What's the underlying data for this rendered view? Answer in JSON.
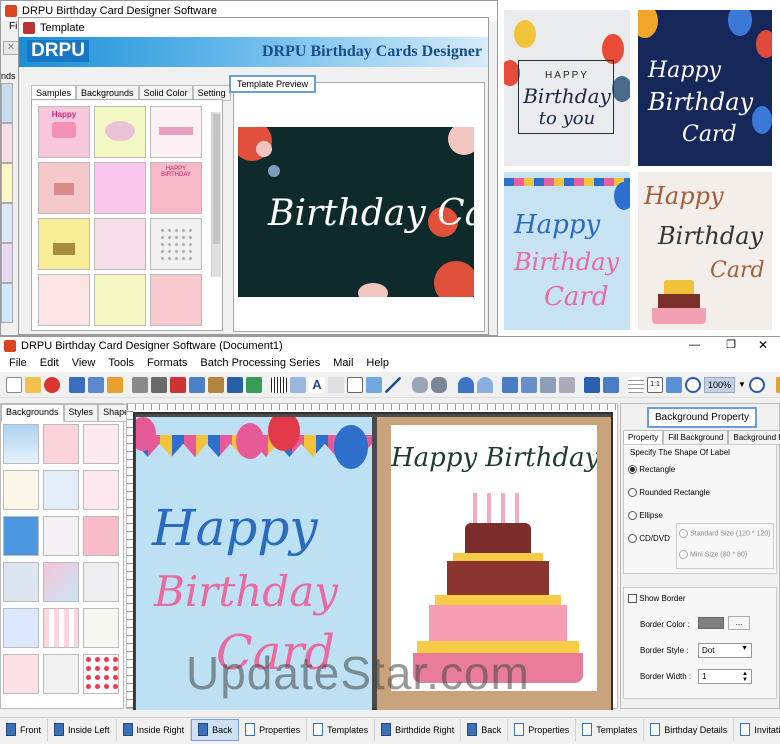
{
  "top_window": {
    "title": "DRPU Birthday Card Designer Software",
    "menu_partial": [
      "File"
    ],
    "left_strip_label": "nds"
  },
  "template_dialog": {
    "title": "Template",
    "logo": "DRPU",
    "banner": "DRPU Birthday Cards Designer",
    "tabs": [
      "Samples",
      "Backgrounds",
      "Solid Color",
      "Setting"
    ],
    "active_tab": "Samples",
    "preview_label": "Template Preview",
    "preview_text": "Birthday Card",
    "thumb_captions": {
      "t1": "Happy",
      "t6": "HAPPY BIRTHDAY"
    }
  },
  "top_right_cards": {
    "card1": [
      "HAPPY",
      "Birthday",
      "to you"
    ],
    "card2": [
      "Happy",
      "Birthday",
      "Card"
    ],
    "card3": [
      "Happy",
      "Birthday",
      "Card"
    ],
    "card4": [
      "Happy",
      "Birthday",
      "Card"
    ]
  },
  "main_window": {
    "title": "DRPU Birthday Card Designer Software (Document1)",
    "menu": [
      "File",
      "Edit",
      "View",
      "Tools",
      "Formats",
      "Batch Processing Series",
      "Mail",
      "Help"
    ],
    "zoom": "100%",
    "left_tabs": [
      "Backgrounds",
      "Styles",
      "Shapes"
    ],
    "active_left_tab": "Backgrounds",
    "canvas": {
      "left_card": [
        "Happy",
        "Birthday",
        "Card"
      ],
      "right_card": [
        "Happy Birthday"
      ]
    },
    "right_panel": {
      "header": "Background Property",
      "tabs": [
        "Property",
        "Fill Background",
        "Background Effects"
      ],
      "active_tab": "Property",
      "group_label": "Specify The Shape Of Label",
      "shapes": [
        "Rectangle",
        "Rounded Rectangle",
        "Ellipse",
        "CD/DVD"
      ],
      "selected_shape": "Rectangle",
      "sizes": [
        "Standard Size (120 * 120)",
        "Mini Size (80 * 80)"
      ],
      "show_border_label": "Show Border",
      "show_border_checked": false,
      "border_color_label": "Border Color :",
      "border_color_value": "#7f7f7f",
      "border_color_btn": "...",
      "border_style_label": "Border Style :",
      "border_style_value": "Dot",
      "border_width_label": "Border Width :",
      "border_width_value": "1"
    },
    "bottom_tabs": [
      "Front",
      "Inside Left",
      "Inside Right",
      "Back",
      "Properties",
      "Templates",
      "Birthdide Right",
      "Back",
      "Properties",
      "Templates",
      "Birthday Details",
      "Invitation Details"
    ],
    "active_bottom_tab": 3
  },
  "watermark": "UpdateStar.com"
}
